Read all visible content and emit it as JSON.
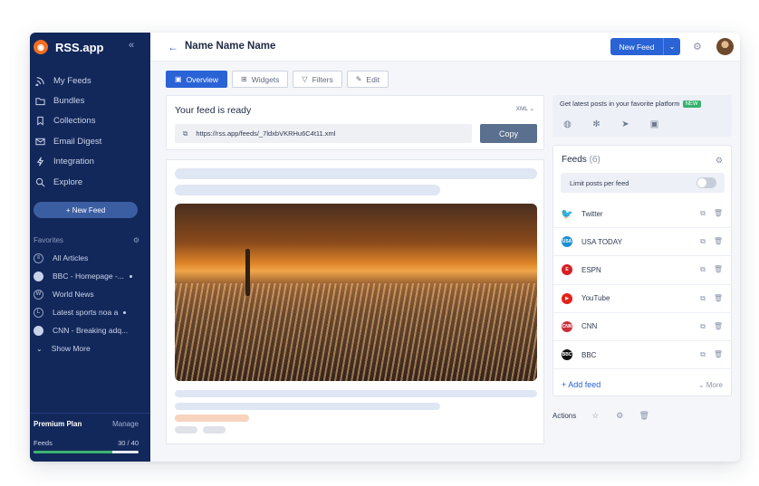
{
  "sidebar": {
    "brand": "RSS.app",
    "collapse_icon": "«",
    "nav": [
      {
        "label": "My Feeds",
        "icon": "rss-icon"
      },
      {
        "label": "Bundles",
        "icon": "folder-icon"
      },
      {
        "label": "Collections",
        "icon": "bookmark-icon"
      },
      {
        "label": "Email Digest",
        "icon": "mail-icon"
      },
      {
        "label": "Integration",
        "icon": "bolt-icon"
      },
      {
        "label": "Explore",
        "icon": "search-icon"
      }
    ],
    "new_feed": "+ New Feed",
    "favorites_label": "Favorites",
    "favorites": [
      {
        "label": "All Articles"
      },
      {
        "label": "BBC - Homepage -..."
      },
      {
        "label": "World News"
      },
      {
        "label": "Latest sports noa a"
      },
      {
        "label": "CNN - Breaking adq..."
      }
    ],
    "show_more": "Show More",
    "premium_label": "Premium Plan",
    "manage_label": "Manage",
    "feeds_label": "Feeds",
    "feeds_usage": "30 / 40",
    "feeds_used_fraction": 0.75
  },
  "header": {
    "title": "Name Name Name",
    "new_feed_button": "New Feed"
  },
  "tabs": [
    {
      "label": "Overview",
      "active": true
    },
    {
      "label": "Widgets",
      "active": false
    },
    {
      "label": "Filters",
      "active": false
    },
    {
      "label": "Edit",
      "active": false
    }
  ],
  "ready": {
    "title": "Your feed is ready",
    "format": "XML ⌄",
    "url": "https://rss.app/feeds/_7ldxbVKRHu6C4t11.xml",
    "copy_label": "Copy"
  },
  "platform": {
    "title": "Get latest posts in your favorite platform",
    "badge": "NEW"
  },
  "feeds": {
    "title": "Feeds",
    "count": "(6)",
    "limit_label": "Limit posts per feed",
    "items": [
      {
        "name": "Twitter",
        "color": "#1d9bf0"
      },
      {
        "name": "USA TODAY",
        "color": "#1b8fd1"
      },
      {
        "name": "ESPN",
        "color": "#d81f26"
      },
      {
        "name": "YouTube",
        "color": "#e62117"
      },
      {
        "name": "CNN",
        "color": "#cc2f3a"
      },
      {
        "name": "BBC",
        "color": "#111111"
      }
    ],
    "add_feed": "+ Add feed",
    "more": "More"
  },
  "actions_label": "Actions"
}
